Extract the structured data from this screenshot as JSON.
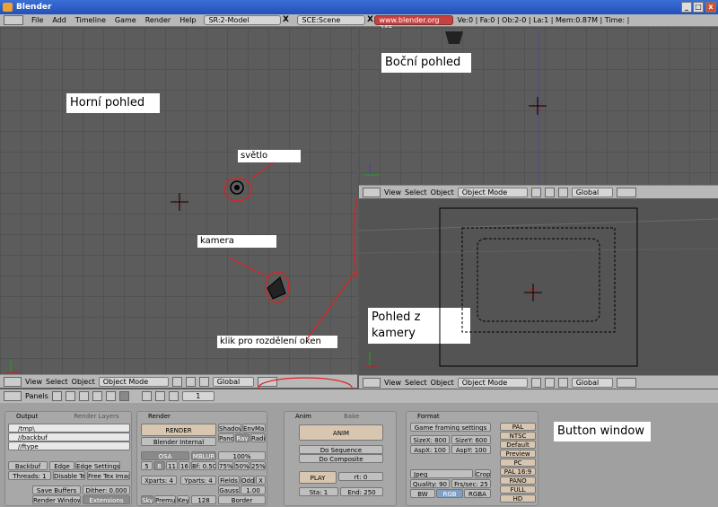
{
  "title": "Blender",
  "menu": [
    "File",
    "Add",
    "Timeline",
    "Game",
    "Render",
    "Help"
  ],
  "screen": "SR:2-Model",
  "scene": "SCE:Scene",
  "url": "www.blender.org 245",
  "stats": "Ve:0 | Fa:0 | Ob:2-0 | La:1 | Mem:0.87M | Time: |",
  "labels": {
    "top": "Horní pohled",
    "side": "Boční pohled",
    "camera": "Pohled z kamery",
    "button": "Button window"
  },
  "annots": {
    "light": "světlo",
    "camera": "kamera",
    "split": "klik pro rozdělení oken"
  },
  "hdr": {
    "view": "View",
    "select": "Select",
    "object": "Object",
    "mode": "Object Mode",
    "global": "Global"
  },
  "btnhdr": {
    "panels": "Panels",
    "frame": "1"
  },
  "output": {
    "tab": "Output",
    "tab2": "Render Layers",
    "p1": "/tmp\\",
    "p2": "//backbuf",
    "p3": "//ftype",
    "backbuf": "Backbuf",
    "edge": "Edge",
    "edgeset": "Edge Settings",
    "threads": "Threads: 1",
    "disable": "Disable Te",
    "freetex": "Free Tex Image",
    "save": "Save Buffers",
    "dither": "Dither: 0.000",
    "renderwin": "Render Window",
    "ext": "Extensions"
  },
  "render": {
    "tab": "Render",
    "btn": "RENDER",
    "engine": "Blender Internal",
    "shadow": "Shadow",
    "envmap": "EnvMap",
    "pano": "Pano",
    "ray": "Ray",
    "radi": "Radi",
    "osa": "OSA",
    "mblur": "MBLUR",
    "n5": "5",
    "n8": "8",
    "n11": "11",
    "n16": "16",
    "bf": "Bf: 0.50",
    "p100": "100%",
    "p75": "75%",
    "p50": "50%",
    "p25": "25%",
    "xparts": "Xparts: 4",
    "yparts": "Yparts: 4",
    "fields": "Fields",
    "odd": "Odd",
    "x": "X",
    "gauss": "Gauss",
    "g1": "1.00",
    "sky": "Sky",
    "premul": "Premul",
    "key": "Key",
    "n128": "128",
    "border": "Border"
  },
  "anim": {
    "tab": "Anim",
    "tab2": "Bake",
    "btn": "ANIM",
    "doseq": "Do Sequence",
    "docomp": "Do Composite",
    "play": "PLAY",
    "rt": "rt: 0",
    "sta": "Sta: 1",
    "end": "End: 250"
  },
  "format": {
    "tab": "Format",
    "game": "Game framing settings",
    "sizex": "SizeX: 800",
    "sizey": "SizeY: 600",
    "aspx": "AspX: 100",
    "aspy": "AspY: 100",
    "jpeg": "Jpeg",
    "crop": "Crop",
    "quality": "Quality: 90",
    "fps": "Frs/sec: 25",
    "bw": "BW",
    "rgb": "RGB",
    "rgba": "RGBA",
    "presets": [
      "PAL",
      "NTSC",
      "Default",
      "Preview",
      "PC",
      "PAL 16:9",
      "PANO",
      "FULL",
      "HD"
    ]
  }
}
